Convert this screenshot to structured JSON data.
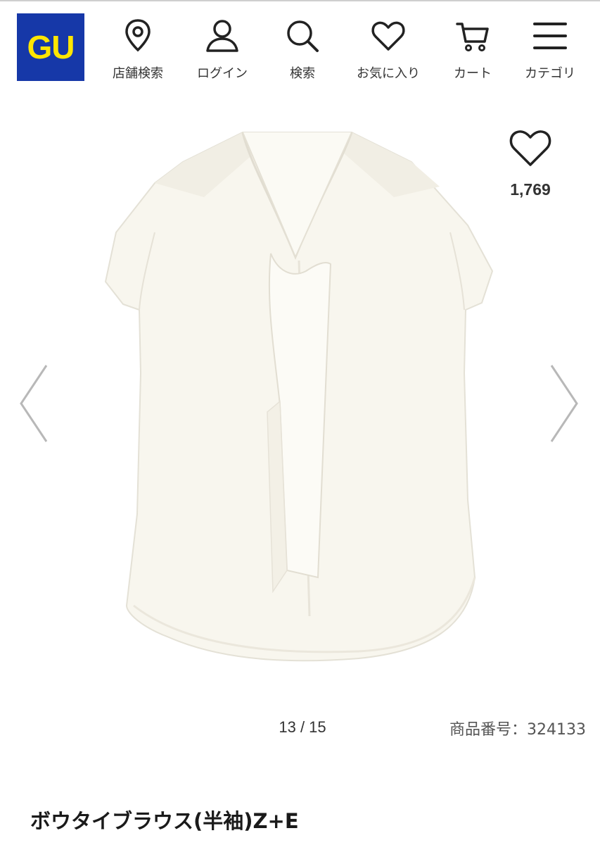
{
  "brand": {
    "logo_text": "GU",
    "logo_bg": "#1638a8",
    "logo_fg": "#ffe600"
  },
  "nav": {
    "items": [
      {
        "label": "店舗検索",
        "icon": "location-pin-icon"
      },
      {
        "label": "ログイン",
        "icon": "user-icon"
      },
      {
        "label": "検索",
        "icon": "search-icon"
      },
      {
        "label": "お気に入り",
        "icon": "heart-icon"
      },
      {
        "label": "カート",
        "icon": "cart-icon"
      },
      {
        "label": "カテゴリ",
        "icon": "menu-icon"
      }
    ]
  },
  "product": {
    "image": "white-sleeveless-bow-tie-blouse",
    "favorite_count": "1,769",
    "pager": "13 / 15",
    "code_text": "商品番号：324133",
    "title": "ボウタイブラウス(半袖)Z+E"
  },
  "carousel": {
    "prev_icon": "chevron-left-icon",
    "next_icon": "chevron-right-icon"
  }
}
